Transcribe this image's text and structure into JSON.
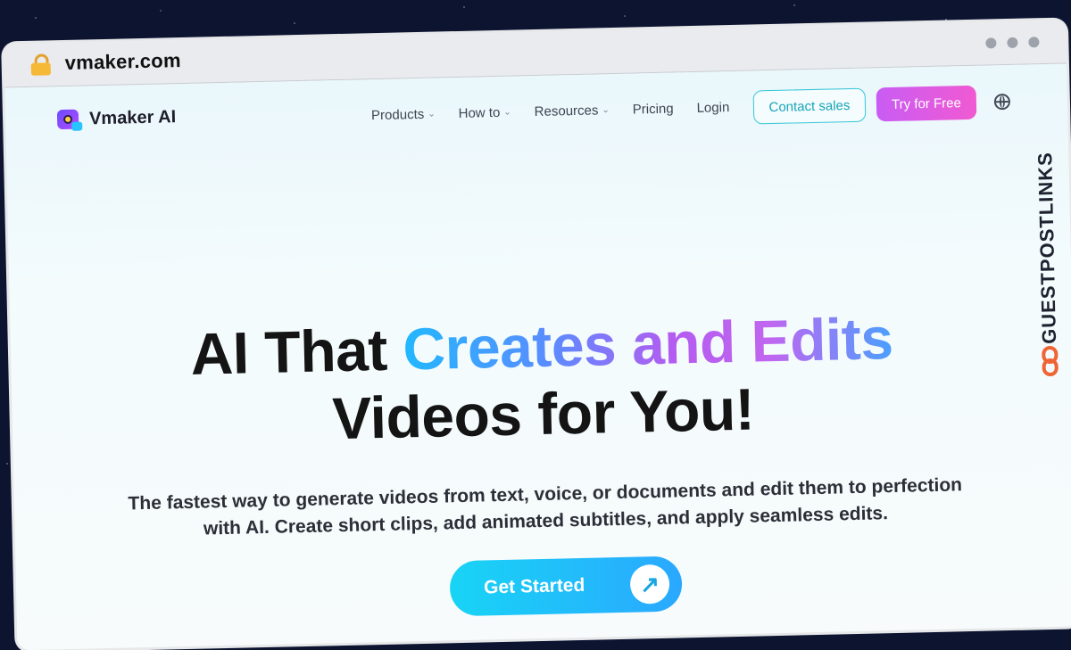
{
  "browser": {
    "url": "vmaker.com"
  },
  "nav": {
    "logo_text": "Vmaker AI",
    "items": [
      {
        "label": "Products",
        "chevron": true
      },
      {
        "label": "How to",
        "chevron": true
      },
      {
        "label": "Resources",
        "chevron": true
      },
      {
        "label": "Pricing",
        "chevron": false
      },
      {
        "label": "Login",
        "chevron": false
      }
    ],
    "contact_label": "Contact sales",
    "try_label": "Try for Free"
  },
  "hero": {
    "title_plain": "AI That ",
    "title_gradient": "Creates and Edits",
    "title_line2": "Videos for You!",
    "subtitle": "The fastest way to generate videos from text, voice, or documents and edit them to perfection with AI. Create short clips, add animated subtitles, and apply seamless edits.",
    "cta_label": "Get Started"
  },
  "watermark": {
    "text": "GUESTPOSTLINKS"
  },
  "colors": {
    "accent_cyan": "#36c6d8",
    "accent_pink": "#f05ad2",
    "lock": "#f5b937",
    "watermark_icon": "#ef6534"
  },
  "icons": [
    "lock-icon",
    "chevron-down-icon",
    "globe-icon",
    "arrow-up-right-icon",
    "link-icon"
  ]
}
